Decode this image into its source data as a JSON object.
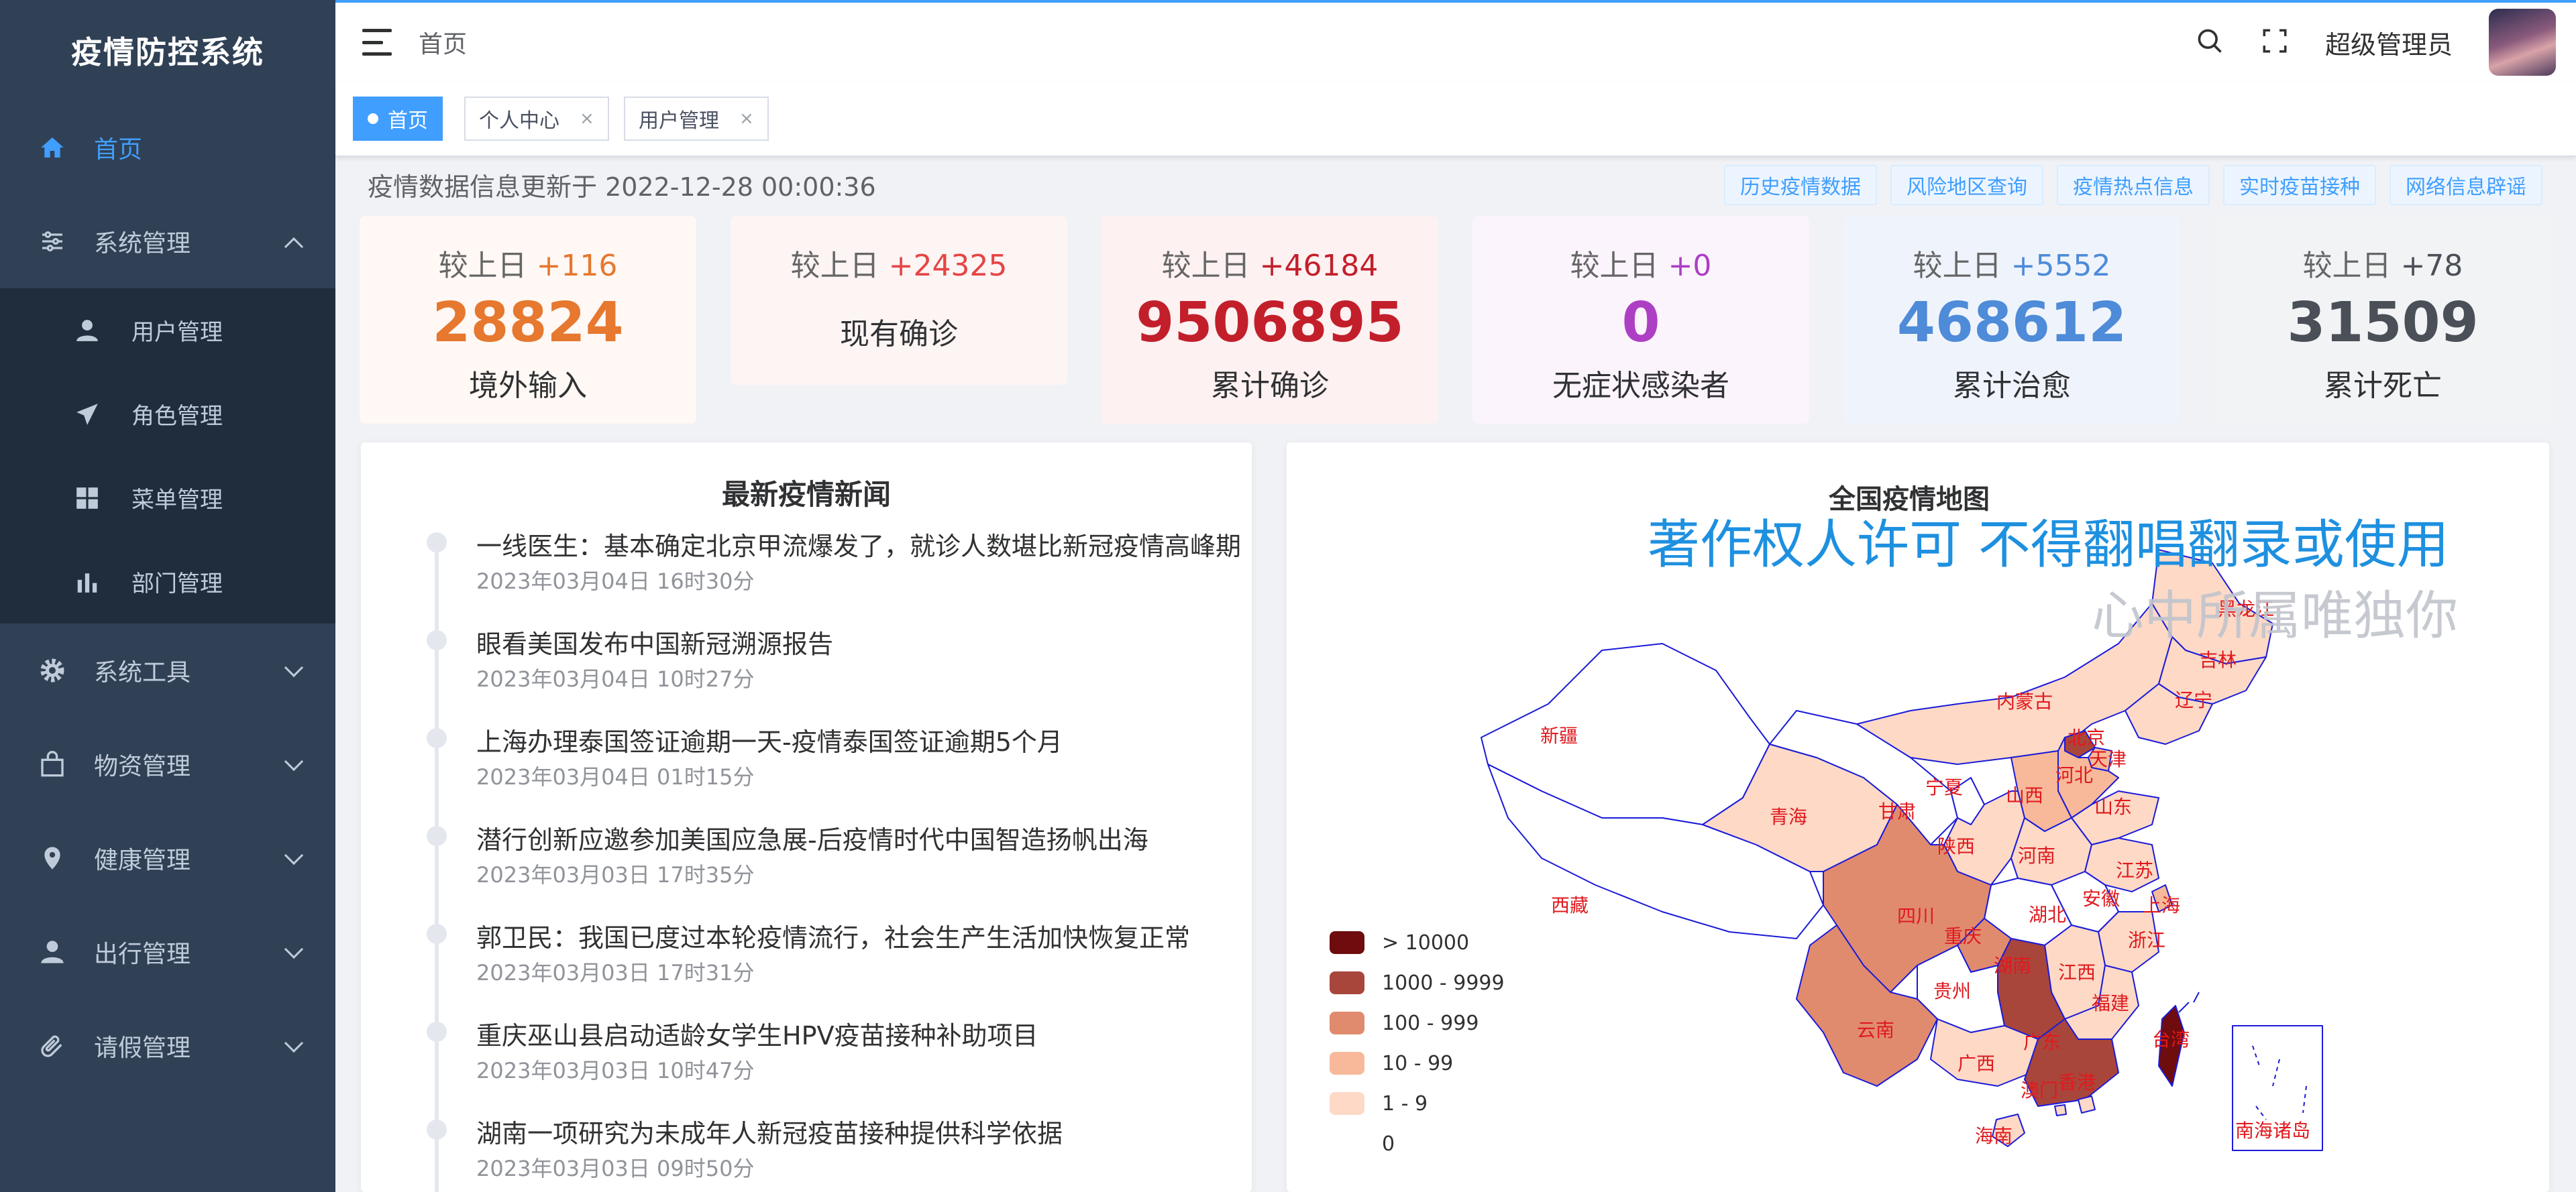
{
  "app": {
    "title": "疫情防控系统"
  },
  "sidebar": {
    "items": [
      {
        "label": "首页",
        "icon": "home-icon",
        "active": true
      },
      {
        "label": "系统管理",
        "icon": "sliders-icon",
        "expanded": true,
        "children": [
          {
            "label": "用户管理",
            "icon": "user-icon"
          },
          {
            "label": "角色管理",
            "icon": "paper-plane-icon"
          },
          {
            "label": "菜单管理",
            "icon": "grid-icon"
          },
          {
            "label": "部门管理",
            "icon": "bar-chart-icon"
          }
        ]
      },
      {
        "label": "系统工具",
        "icon": "gear-icon"
      },
      {
        "label": "物资管理",
        "icon": "shopping-bag-icon"
      },
      {
        "label": "健康管理",
        "icon": "location-pin-icon"
      },
      {
        "label": "出行管理",
        "icon": "person-icon"
      },
      {
        "label": "请假管理",
        "icon": "paperclip-icon"
      }
    ]
  },
  "header": {
    "breadcrumb": "首页",
    "user": "超级管理员"
  },
  "tags": [
    {
      "label": "首页",
      "active": true
    },
    {
      "label": "个人中心",
      "closable": true
    },
    {
      "label": "用户管理",
      "closable": true
    }
  ],
  "update": {
    "text": "疫情数据信息更新于 2022-12-28 00:00:36"
  },
  "quick_links": [
    "历史疫情数据",
    "风险地区查询",
    "疫情热点信息",
    "实时疫苗接种",
    "网络信息辟谣"
  ],
  "stats": [
    {
      "delta_label": "较上日",
      "delta": "+116",
      "value": "28824",
      "label": "境外输入",
      "color": "#e6782f",
      "bg": "#fff8f4"
    },
    {
      "delta_label": "较上日",
      "delta": "+24325",
      "value": "",
      "label": "现有确诊",
      "color": "#e54545",
      "bg": "#fdf4f4"
    },
    {
      "delta_label": "较上日",
      "delta": "+46184",
      "value": "9506895",
      "label": "累计确诊",
      "color": "#c21f2b",
      "bg": "#fdf1f1"
    },
    {
      "delta_label": "较上日",
      "delta": "+0",
      "value": "0",
      "label": "无症状感染者",
      "color": "#ad3fc4",
      "bg": "#fcf4fd"
    },
    {
      "delta_label": "较上日",
      "delta": "+5552",
      "value": "468612",
      "label": "累计治愈",
      "color": "#4e8bd8",
      "bg": "#eff4fc"
    },
    {
      "delta_label": "较上日",
      "delta": "+78",
      "value": "31509",
      "label": "累计死亡",
      "color": "#4a4f58",
      "bg": "#f2f3f5"
    }
  ],
  "news": {
    "title": "最新疫情新闻",
    "items": [
      {
        "text": "一线医生：基本确定北京甲流爆发了，就诊人数堪比新冠疫情高峰期",
        "time": "2023年03月04日 16时30分"
      },
      {
        "text": "眼看美国发布中国新冠溯源报告",
        "time": "2023年03月04日 10时27分"
      },
      {
        "text": "上海办理泰国签证逾期一天-疫情泰国签证逾期5个月",
        "time": "2023年03月04日 01时15分"
      },
      {
        "text": "潜行创新应邀参加美国应急展-后疫情时代中国智造扬帆出海",
        "time": "2023年03月03日 17时35分"
      },
      {
        "text": "郭卫民：我国已度过本轮疫情流行，社会生产生活加快恢复正常",
        "time": "2023年03月03日 17时31分"
      },
      {
        "text": "重庆巫山县启动适龄女学生HPV疫苗接种补助项目",
        "time": "2023年03月03日 10时47分"
      },
      {
        "text": "湖南一项研究为未成年人新冠疫苗接种提供科学依据",
        "time": "2023年03月03日 09时50分"
      }
    ]
  },
  "map": {
    "title": "全国疫情地图",
    "watermark_top": "著作权人许可 不得翻唱翻录或使用",
    "watermark_bottom": "心中所属唯独你",
    "legend": [
      {
        "label": "> 10000",
        "color": "#6e0c0e"
      },
      {
        "label": "1000 - 9999",
        "color": "#a8463c"
      },
      {
        "label": "100 - 999",
        "color": "#e08b6e"
      },
      {
        "label": "10 - 99",
        "color": "#f7b99a"
      },
      {
        "label": "1 - 9",
        "color": "#fdd9c6"
      },
      {
        "label": "0",
        "color": "#ffffff"
      }
    ],
    "provinces": [
      "新疆",
      "西藏",
      "青海",
      "甘肃",
      "内蒙古",
      "黑龙江",
      "吉林",
      "辽宁",
      "北京",
      "天津",
      "河北",
      "山西",
      "山东",
      "宁夏",
      "陕西",
      "河南",
      "江苏",
      "上海",
      "安徽",
      "湖北",
      "四川",
      "重庆",
      "浙江",
      "江西",
      "湖南",
      "贵州",
      "云南",
      "福建",
      "台湾",
      "广西",
      "广东",
      "香港",
      "澳门",
      "海南",
      "南海诸岛"
    ]
  }
}
